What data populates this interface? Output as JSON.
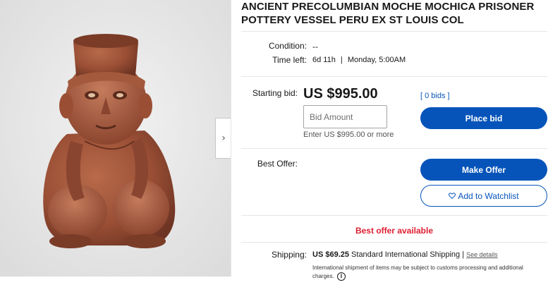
{
  "listing": {
    "title_line1": "ANCIENT PRECOLUMBIAN MOCHE MOCHICA PRISONER",
    "title_line2": "POTTERY VESSEL PERU EX ST LOUIS COL"
  },
  "details": {
    "condition_label": "Condition:",
    "condition_value": "--",
    "time_left_label": "Time left:",
    "time_left_value": "6d 11h",
    "end_sep": "|",
    "end_time": "Monday, 5:00AM"
  },
  "bidding": {
    "starting_bid_label": "Starting bid:",
    "starting_bid_value": "US $995.00",
    "bids_count": "[ 0 bids ]",
    "bid_placeholder": "Bid Amount",
    "enter_hint": "Enter US $995.00 or more",
    "place_bid_label": "Place bid"
  },
  "offer": {
    "best_offer_label": "Best Offer:",
    "make_offer_label": "Make Offer",
    "watchlist_icon": "heart-icon",
    "watchlist_label": "Add to Watchlist",
    "best_offer_available": "Best offer available"
  },
  "shipping": {
    "label": "Shipping:",
    "price": "US $69.25",
    "method": "Standard International Shipping",
    "sep": "|",
    "see_details": "See details",
    "note": "International shipment of items may be subject to customs processing and additional charges."
  },
  "gallery": {
    "next_icon": "chevron-right-icon",
    "next_glyph": "›"
  },
  "colors": {
    "accent": "#0654ba",
    "alert": "#dd1e31"
  }
}
